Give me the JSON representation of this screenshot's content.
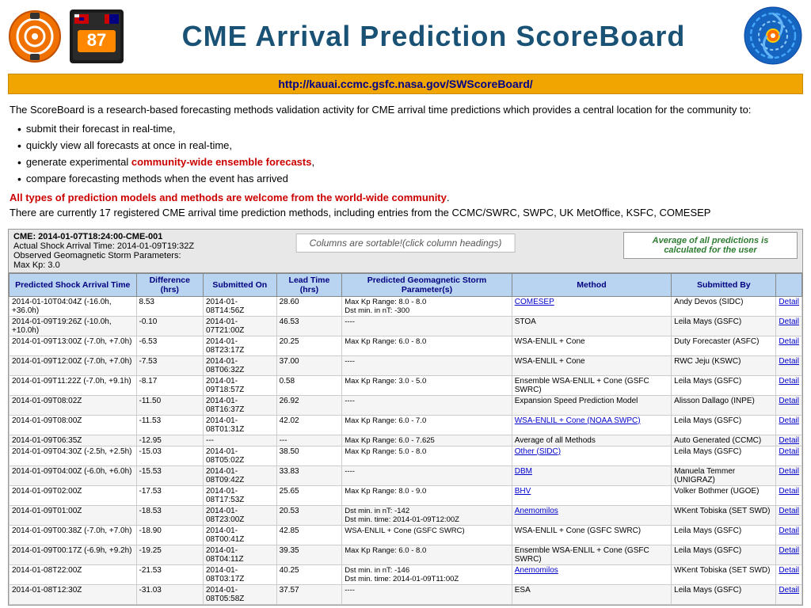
{
  "header": {
    "title": "CME Arrival Prediction ScoreBoard",
    "url": "http://kauai.ccmc.gsfc.nasa.gov/SWScoreBoard/"
  },
  "description": {
    "intro": "The ScoreBoard is a research-based forecasting methods validation activity for CME arrival time predictions which provides a central location for the community to:",
    "bullets": [
      "submit their forecast in real-time,",
      "quickly view all forecasts at once in real-time,",
      "generate experimental community-wide ensemble forecasts,",
      "compare forecasting methods when the event has arrived"
    ],
    "ensemble_text": "community-wide ensemble forecasts",
    "all_welcome": "All types of prediction models and methods are welcome from the world-wide community",
    "count_text": "There are currently 17 registered CME arrival time prediction methods, including entries from the CCMC/SWRC, SWPC, UK MetOffice, KSFC, COMESEP"
  },
  "table": {
    "cme_id": "CME: 2014-01-07T18:24:00-CME-001",
    "actual_shock": "2014-01-09T19:32Z",
    "observed_params": "Observed Geomagnetic Storm Parameters:",
    "max_kp": "Max Kp: 3.0",
    "sortable_note": "Columns are sortable!(click column headings)",
    "avg_note": "Average of all predictions is calculated for the user",
    "columns": [
      "Predicted Shock Arrival Time",
      "Difference (hrs)",
      "Submitted On",
      "Lead Time (hrs)",
      "Predicted Geomagnetic Storm Parameter(s)",
      "Method",
      "Submitted By",
      ""
    ],
    "rows": [
      {
        "arrival": "2014-01-10T04:04Z (-16.0h, +36.0h)",
        "diff": "8.53",
        "submitted": "2014-01-08T14:56Z",
        "lead": "28.60",
        "params": "Max Kp Range: 8.0 - 8.0\nDst min. in nT: -300",
        "method": "COMESEP",
        "method_link": true,
        "submitted_by": "Andy Devos (SIDC)",
        "detail": "Detail"
      },
      {
        "arrival": "2014-01-09T19:26Z (-10.0h, +10.0h)",
        "diff": "-0.10",
        "submitted": "2014-01-07T21:00Z",
        "lead": "46.53",
        "params": "----",
        "method": "STOA",
        "method_link": false,
        "submitted_by": "Leila Mays (GSFC)",
        "detail": "Detail"
      },
      {
        "arrival": "2014-01-09T13:00Z (-7.0h, +7.0h)",
        "diff": "-6.53",
        "submitted": "2014-01-08T23:17Z",
        "lead": "20.25",
        "params": "Max Kp Range: 6.0 - 8.0",
        "method": "WSA-ENLIL + Cone",
        "method_link": false,
        "submitted_by": "Duty Forecaster (ASFC)",
        "detail": "Detail"
      },
      {
        "arrival": "2014-01-09T12:00Z (-7.0h, +7.0h)",
        "diff": "-7.53",
        "submitted": "2014-01-08T06:32Z",
        "lead": "37.00",
        "params": "----",
        "method": "WSA-ENLIL + Cone",
        "method_link": false,
        "submitted_by": "RWC Jeju (KSWC)",
        "detail": "Detail"
      },
      {
        "arrival": "2014-01-09T11:22Z (-7.0h, +9.1h)",
        "diff": "-8.17",
        "submitted": "2014-01-09T18:57Z",
        "lead": "0.58",
        "params": "Max Kp Range: 3.0 - 5.0",
        "method": "Ensemble WSA-ENLIL + Cone (GSFC SWRC)",
        "method_link": false,
        "submitted_by": "Leila Mays (GSFC)",
        "detail": "Detail"
      },
      {
        "arrival": "2014-01-09T08:02Z",
        "diff": "-11.50",
        "submitted": "2014-01-08T16:37Z",
        "lead": "26.92",
        "params": "----",
        "method": "Expansion Speed Prediction Model",
        "method_link": false,
        "submitted_by": "Alisson Dallago (INPE)",
        "detail": "Detail"
      },
      {
        "arrival": "2014-01-09T08:00Z",
        "diff": "-11.53",
        "submitted": "2014-01-08T01:31Z",
        "lead": "42.02",
        "params": "Max Kp Range: 6.0 - 7.0",
        "method": "WSA-ENLIL + Cone (NOAA SWPC)",
        "method_link": true,
        "submitted_by": "Leila Mays (GSFC)",
        "detail": "Detail"
      },
      {
        "arrival": "2014-01-09T06:35Z",
        "diff": "-12.95",
        "submitted": "---",
        "lead": "---",
        "params": "Max Kp Range: 6.0 - 7.625",
        "method": "Average of all Methods",
        "method_link": false,
        "submitted_by": "Auto Generated (CCMC)",
        "detail": "Detail"
      },
      {
        "arrival": "2014-01-09T04:30Z (-2.5h, +2.5h)",
        "diff": "-15.03",
        "submitted": "2014-01-08T05:02Z",
        "lead": "38.50",
        "params": "Max Kp Range: 5.0 - 8.0",
        "method": "Other (SIDC)",
        "method_link": true,
        "submitted_by": "Leila Mays (GSFC)",
        "detail": "Detail"
      },
      {
        "arrival": "2014-01-09T04:00Z (-6.0h, +6.0h)",
        "diff": "-15.53",
        "submitted": "2014-01-08T09:42Z",
        "lead": "33.83",
        "params": "----",
        "method": "DBM",
        "method_link": true,
        "submitted_by": "Manuela Temmer (UNIGRAZ)",
        "detail": "Detail"
      },
      {
        "arrival": "2014-01-09T02:00Z",
        "diff": "-17.53",
        "submitted": "2014-01-08T17:53Z",
        "lead": "25.65",
        "params": "Max Kp Range: 8.0 - 9.0",
        "method": "BHV",
        "method_link": true,
        "submitted_by": "Volker Bothmer (UGOE)",
        "detail": "Detail"
      },
      {
        "arrival": "2014-01-09T01:00Z",
        "diff": "-18.53",
        "submitted": "2014-01-08T23:00Z",
        "lead": "20.53",
        "params": "Dst min. in nT: -142\nDst min. time: 2014-01-09T12:00Z",
        "method": "Anemomilos",
        "method_link": true,
        "submitted_by": "WKent Tobiska (SET SWD)",
        "detail": "Detail"
      },
      {
        "arrival": "2014-01-09T00:38Z (-7.0h, +7.0h)",
        "diff": "-18.90",
        "submitted": "2014-01-08T00:41Z",
        "lead": "42.85",
        "params": "WSA-ENLIL + Cone (GSFC SWRC)",
        "method": "WSA-ENLIL + Cone (GSFC SWRC)",
        "method_link": false,
        "submitted_by": "Leila Mays (GSFC)",
        "detail": "Detail"
      },
      {
        "arrival": "2014-01-09T00:17Z (-6.9h, +9.2h)",
        "diff": "-19.25",
        "submitted": "2014-01-08T04:11Z",
        "lead": "39.35",
        "params": "Max Kp Range: 6.0 - 8.0",
        "method": "Ensemble WSA-ENLIL + Cone (GSFC SWRC)",
        "method_link": false,
        "submitted_by": "Leila Mays (GSFC)",
        "detail": "Detail"
      },
      {
        "arrival": "2014-01-08T22:00Z",
        "diff": "-21.53",
        "submitted": "2014-01-08T03:17Z",
        "lead": "40.25",
        "params": "Dst min. in nT: -146\nDst min. time: 2014-01-09T11:00Z",
        "method": "Anemomilos",
        "method_link": true,
        "submitted_by": "WKent Tobiska (SET SWD)",
        "detail": "Detail"
      },
      {
        "arrival": "2014-01-08T12:30Z",
        "diff": "-31.03",
        "submitted": "2014-01-08T05:58Z",
        "lead": "37.57",
        "params": "----",
        "method": "ESA",
        "method_link": false,
        "submitted_by": "Leila Mays (GSFC)",
        "detail": "Detail"
      }
    ]
  }
}
